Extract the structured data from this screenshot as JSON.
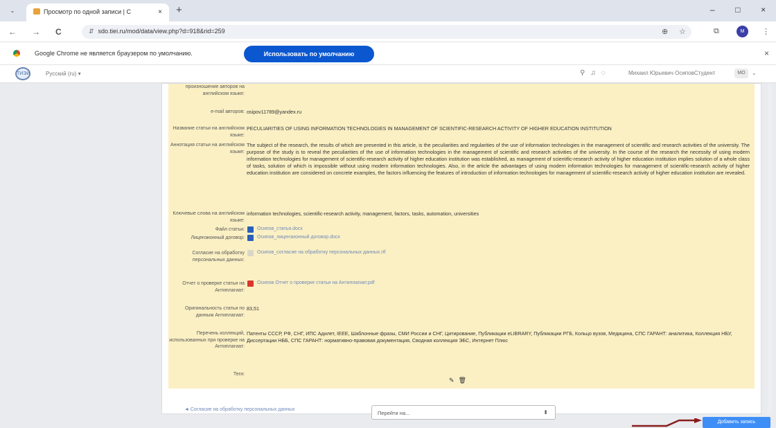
{
  "tab": {
    "control": "⌄",
    "title": "Просмотр по одной записи | С",
    "close": "×",
    "new_tab": "+"
  },
  "window": {
    "minimize": "–",
    "maximize": "□",
    "close": "×"
  },
  "address_bar": {
    "back": "←",
    "forward": "→",
    "reload": "C",
    "url": "sdo.tiei.ru/mod/data/view.php?d=918&rid=259",
    "profile_initials": "M"
  },
  "infobar": {
    "message": "Google Chrome не является браузером по умолчанию.",
    "button": "Использовать по умолчанию",
    "close": "×"
  },
  "site_header": {
    "language": "Русский (ru) ▾",
    "user_name": "Михаил Юрьевич ОсиповСтудент",
    "user_initials": "MO",
    "menu_arrow": "⌄"
  },
  "entry": {
    "fields": [
      {
        "label": "произношение авторов на английском языке:",
        "value": ""
      },
      {
        "label": "e-mail авторов:",
        "value": "osipov11789@yandex.ru"
      },
      {
        "label": "Название статьи на английском языке:",
        "value": "PECULIARITIES OF USING INFORMATION TECHNOLOGIES IN MANAGEMENT OF SCIENTIFIC-RESEARCH ACTIVITY OF HIGHER EDUCATION INSTITUTION"
      },
      {
        "label": "Аннотация статьи на английском языке:",
        "value": "The subject of the research, the results of which are presented in this article, is the peculiarities and regularities of the use of information technologies in the management of scientific and research activities of the university. The purpose of the study is to reveal the peculiarities of the use of information technologies in the management of scientific and research activities of the university. In the course of the research the necessity of using modern information technologies for management of scientific-research activity of higher education institution was established, as management of scientific-research activity of higher education institution implies solution of a whole class of tasks, solution of which is impossible without using modern information technologies. Also, in the article the advantages of using modern information technologies for management of scientific-research activity of higher education institution are considered on concrete examples, the factors influencing the features of introduction of information technologies for management of scientific-research activity of higher education institution are revealed."
      },
      {
        "label": "Ключевые слова на английском языке:",
        "value": "information technologies, scientific-research activity, management, factors, tasks, automation, universities"
      },
      {
        "label": "Файл статьи:",
        "file": "Осипов_статья.docx"
      },
      {
        "label": "Лицензионный договор:",
        "file": "Осипов_лицензионный договор.docx"
      },
      {
        "label": "Согласие на обработку персональных данных:",
        "file": "Осипов_согласие на обработку персональных данных.rtf"
      },
      {
        "label": "Отчет о проверке статьи на Антиплагиат:",
        "file": "Осипов Отчет о проверке статьи на Антиплагиат.pdf"
      },
      {
        "label": "Оригинальность статьи по данным Антиплагиат:",
        "value": "83,51"
      },
      {
        "label": "Перечень коллекций, использованных при проверке на Антиплагиат:",
        "value": "Патенты СССР, РФ, СНГ, ИПС Адилет, IEEE, Шаблонные фразы, СМИ России и СНГ, Цитирование, Публикации eLIBRARY, Публикации РГБ, Кольцо вузов, Медицина, СПС ГАРАНТ: аналитика, Коллекция НБУ, Диссертации НББ, СПС ГАРАНТ: нормативно-правовая документация, Сводная коллекция ЭБС, Интернет Плюс"
      },
      {
        "label": "Теги:",
        "value": ""
      }
    ],
    "edit_icon": "✎",
    "delete_icon": "🗑"
  },
  "footer": {
    "prev_link": "◄ Согласие на обработку персональных данных",
    "jump_placeholder": "Перейти на...",
    "jump_arrow": "⬍",
    "add_button": "Добавить запись"
  },
  "colors": {
    "entry_bg": "#fbf0c4",
    "link": "#6f89b8",
    "accent": "#0b57d0",
    "annotation_arrow": "#8a1c1c"
  }
}
